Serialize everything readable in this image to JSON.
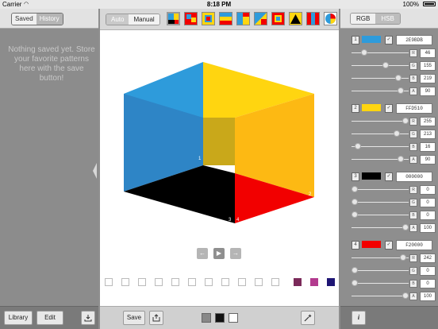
{
  "status": {
    "carrier": "Carrier",
    "time": "8:18 PM",
    "battery": "100%"
  },
  "left": {
    "tab_saved": "Saved",
    "tab_history": "History",
    "empty_message": "Nothing saved yet. Store your favorite patterns here with the save button!",
    "library_label": "Library",
    "edit_label": "Edit"
  },
  "center": {
    "mode_auto": "Auto",
    "mode_manual": "Manual",
    "save_label": "Save",
    "cube": {
      "colors": {
        "top_left": "#2E9BDB",
        "top_right": "#FFD510",
        "left_face": "#2E9BDB",
        "right_face": "#FFD510",
        "bottom_left": "#000000",
        "bottom_right": "#F20000"
      },
      "labels": [
        "1",
        "2",
        "3",
        "4"
      ]
    },
    "slot_colors": [
      "#7B2A5A",
      "#B23A8E",
      "#1E1574"
    ]
  },
  "right": {
    "tab_rgb": "RGB",
    "tab_hsb": "HSB",
    "colors": [
      {
        "index": "1",
        "hex": "2E9BDB",
        "swatch": "#2E9BDB",
        "r": "46",
        "g": "155",
        "b": "219",
        "a": "90"
      },
      {
        "index": "2",
        "hex": "FFD510",
        "swatch": "#FFD510",
        "r": "255",
        "g": "213",
        "b": "16",
        "a": "90"
      },
      {
        "index": "3",
        "hex": "000000",
        "swatch": "#000000",
        "r": "0",
        "g": "0",
        "b": "0",
        "a": "100"
      },
      {
        "index": "4",
        "hex": "F20000",
        "swatch": "#F20000",
        "r": "242",
        "g": "0",
        "b": "0",
        "a": "100"
      }
    ]
  }
}
